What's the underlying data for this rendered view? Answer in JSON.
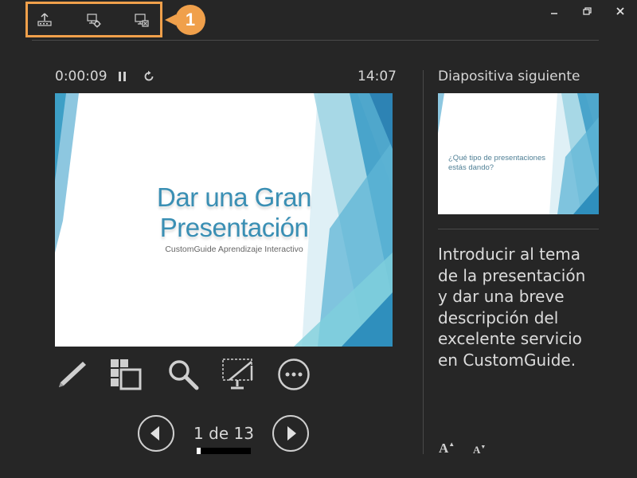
{
  "callout": {
    "number": "1"
  },
  "toolbar": {
    "icons": [
      "taskbar-icon",
      "display-settings-icon",
      "end-slideshow-icon"
    ]
  },
  "window": {
    "controls": [
      "minimize-icon",
      "restore-icon",
      "close-icon"
    ]
  },
  "presenter": {
    "elapsed_time": "0:00:09",
    "clock": "14:07"
  },
  "current_slide": {
    "title_line1": "Dar una Gran",
    "title_line2": "Presentación",
    "subtitle": "CustomGuide Aprendizaje Interactivo",
    "accent_color": "#3a8fb4"
  },
  "navigation": {
    "indicator": "1 de 13",
    "progress": 0.077
  },
  "next_slide": {
    "label": "Diapositiva siguiente",
    "text_line1": "¿Qué tipo de presentaciones",
    "text_line2": "estás dando?"
  },
  "notes": {
    "lines": [
      "Introducir al tema",
      "de la presentación",
      "y dar una breve",
      "descripción del",
      "excelente servicio",
      "en CustomGuide."
    ]
  },
  "font_controls": {
    "increase": "A",
    "decrease": "A"
  }
}
